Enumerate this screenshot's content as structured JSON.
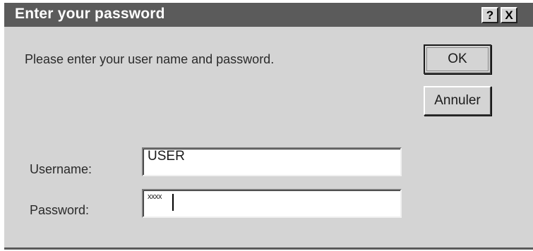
{
  "dialog": {
    "title": "Enter your password",
    "help_button": "?",
    "close_button": "X",
    "prompt": "Please enter your user name and password.",
    "ok_label": "OK",
    "cancel_label": "Annuler"
  },
  "form": {
    "username": {
      "label": "Username:",
      "value": "USER"
    },
    "password": {
      "label": "Password:",
      "masked_value": "xxxx"
    }
  },
  "colors": {
    "titlebar": "#5b5b5b",
    "face": "#d4d4d4"
  }
}
